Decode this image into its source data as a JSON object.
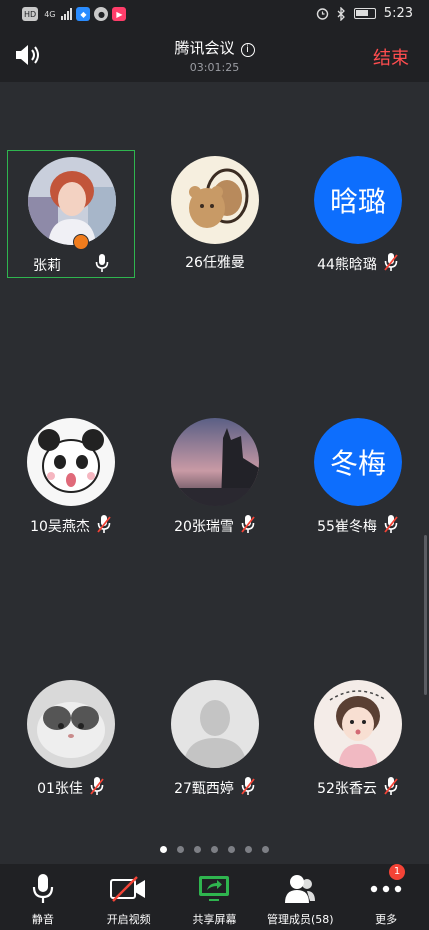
{
  "status_bar": {
    "network_tags": [
      "HD",
      "4G"
    ],
    "time": "5:23"
  },
  "header": {
    "title": "腾讯会议",
    "duration": "03:01:25",
    "end_label": "结束"
  },
  "participants": [
    {
      "name": "张莉",
      "avatar": "photo-woman",
      "avatar_text": "",
      "mic": "on",
      "active": true
    },
    {
      "name": "26任雅曼",
      "avatar": "photo-bear",
      "avatar_text": "",
      "mic": "none",
      "active": false
    },
    {
      "name": "44熊晗璐",
      "avatar": "initials",
      "avatar_text": "晗璐",
      "mic": "muted",
      "active": false
    },
    {
      "name": "10吴燕杰",
      "avatar": "photo-panda",
      "avatar_text": "",
      "mic": "muted",
      "active": false
    },
    {
      "name": "20张瑞雪",
      "avatar": "photo-sunset",
      "avatar_text": "",
      "mic": "muted",
      "active": false
    },
    {
      "name": "55崔冬梅",
      "avatar": "initials",
      "avatar_text": "冬梅",
      "mic": "muted",
      "active": false
    },
    {
      "name": "01张佳",
      "avatar": "photo-cat",
      "avatar_text": "",
      "mic": "muted",
      "active": false
    },
    {
      "name": "27甄西婷",
      "avatar": "default-person",
      "avatar_text": "",
      "mic": "muted",
      "active": false
    },
    {
      "name": "52张香云",
      "avatar": "photo-baby",
      "avatar_text": "",
      "mic": "muted",
      "active": false
    }
  ],
  "pagination": {
    "total": 7,
    "current": 0
  },
  "toolbar": {
    "mute_label": "静音",
    "video_label": "开启视频",
    "share_label": "共享屏幕",
    "members_label": "管理成员(58)",
    "more_label": "更多",
    "more_badge": "1"
  },
  "colors": {
    "accent_green": "#2fb54f",
    "end_red": "#ff4d4f",
    "initials_blue": "#0d6efd",
    "host_orange": "#f07c1d"
  }
}
